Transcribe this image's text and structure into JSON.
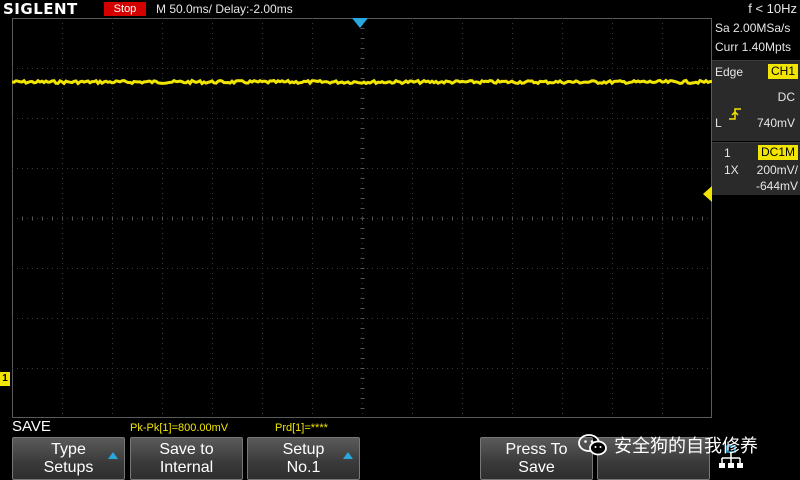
{
  "header": {
    "logo": "SIGLENT",
    "run_state": "Stop",
    "timebase": "M 50.0ms/ Delay:-2.00ms",
    "frequency": "f < 10Hz"
  },
  "right_panel": {
    "sample_rate": "Sa 2.00MSa/s",
    "memory_depth": "Curr 1.40Mpts",
    "trigger_type": "Edge",
    "trigger_source": "CH1",
    "trigger_coupling": "DC",
    "trigger_level_label": "L",
    "trigger_level": "740mV",
    "channel_number": "1",
    "channel_coupling": "DC1M",
    "probe": "1X",
    "volts_per_div": "200mV/",
    "offset": "-644mV",
    "trigger_slope_icon": "rising-edge-icon"
  },
  "markers": {
    "ch1_label": "1"
  },
  "status": {
    "menu_title": "SAVE",
    "measurement_pkpk": "Pk-Pk[1]=800.00mV",
    "measurement_prd": "Prd[1]=****"
  },
  "softkeys": [
    {
      "line1": "Type",
      "line2": "Setups"
    },
    {
      "line1": "Save to",
      "line2": "Internal"
    },
    {
      "line1": "Setup",
      "line2": "No.1"
    },
    {
      "line1": "",
      "line2": ""
    },
    {
      "line1": "Press To",
      "line2": "Save"
    },
    {
      "line1": "",
      "line2": ""
    }
  ],
  "watermark": {
    "text": "安全狗的自我修养",
    "icon": "wechat-icon"
  },
  "colors": {
    "trace": "#f2e600",
    "trigger_marker": "#29a8e0",
    "stop_badge": "#d40000"
  }
}
